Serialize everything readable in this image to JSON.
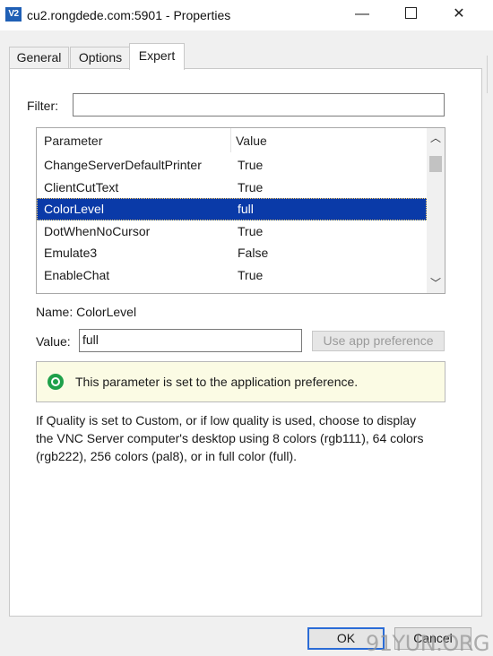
{
  "window": {
    "icon_text": "V2",
    "title": "cu2.rongdede.com:5901 - Properties",
    "controls": {
      "minimize": "—",
      "maximize": "",
      "close": "✕"
    }
  },
  "tabs": [
    {
      "label": "General",
      "active": false
    },
    {
      "label": "Options",
      "active": false
    },
    {
      "label": "Expert",
      "active": true
    }
  ],
  "filter": {
    "label": "Filter:",
    "value": ""
  },
  "list": {
    "headers": {
      "parameter": "Parameter",
      "value": "Value"
    },
    "rows": [
      {
        "parameter": "ChangeServerDefaultPrinter",
        "value": "True"
      },
      {
        "parameter": "ClientCutText",
        "value": "True"
      },
      {
        "parameter": "ColorLevel",
        "value": "full",
        "selected": true
      },
      {
        "parameter": "DotWhenNoCursor",
        "value": "True"
      },
      {
        "parameter": "Emulate3",
        "value": "False"
      },
      {
        "parameter": "EnableChat",
        "value": "True"
      }
    ],
    "scroll": {
      "up": "︿",
      "down": "﹀"
    }
  },
  "name_line": "Name: ColorLevel",
  "value_field": {
    "label": "Value:",
    "value": "full"
  },
  "use_app_pref_button": "Use app preference",
  "info_message": "This parameter is set to the application preference.",
  "description": "If Quality is set to Custom, or if low quality is used, choose to display the VNC Server computer's desktop using 8 colors (rgb111), 64 colors (rgb222), 256 colors (pal8), or in full color (full).",
  "buttons": {
    "ok": "OK",
    "cancel": "Cancel"
  },
  "watermark": "91YUN.ORG",
  "colors": {
    "selection": "#0a3aa8",
    "info_bg": "#fbfbe4",
    "check": "#1ea04a",
    "ok_border": "#2b6cd6"
  }
}
